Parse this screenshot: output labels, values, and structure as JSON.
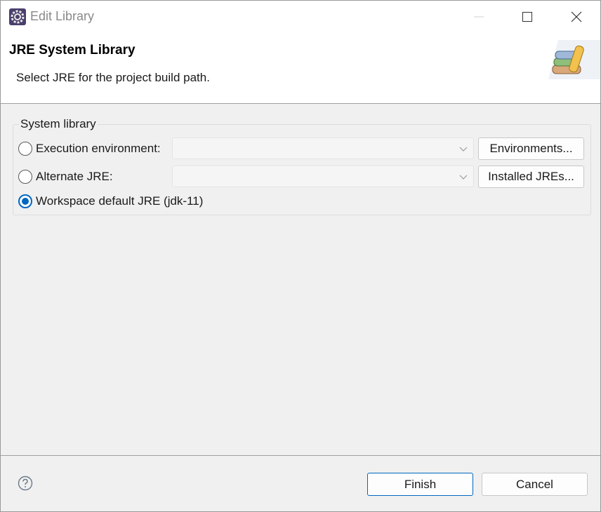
{
  "window": {
    "title": "Edit Library"
  },
  "header": {
    "title": "JRE System Library",
    "description": "Select JRE for the project build path."
  },
  "group": {
    "label": "System library",
    "options": [
      {
        "label": "Execution environment:",
        "selected": false,
        "combo_value": "",
        "button": "Environments..."
      },
      {
        "label": "Alternate JRE:",
        "selected": false,
        "combo_value": "",
        "button": "Installed JREs..."
      },
      {
        "label": "Workspace default JRE (jdk-11)",
        "selected": true
      }
    ]
  },
  "footer": {
    "finish": "Finish",
    "cancel": "Cancel"
  },
  "icons": {
    "app": "eclipse-gear-icon",
    "header": "library-books-icon",
    "help": "help-question-icon",
    "combo": "chevron-down-icon"
  },
  "colors": {
    "accent": "#0067c0",
    "background": "#f0f0f0",
    "header_bg": "#ffffff"
  }
}
